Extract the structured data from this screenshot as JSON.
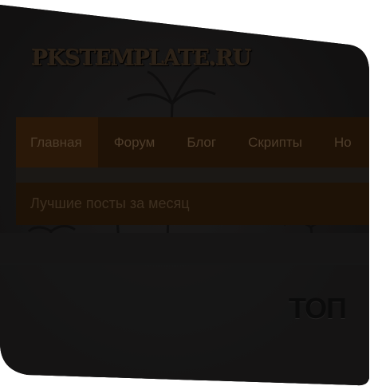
{
  "site": {
    "logo_text": "PKSTEMPLATE.RU"
  },
  "nav": {
    "items": [
      {
        "label": "Главная",
        "active": true
      },
      {
        "label": "Форум",
        "active": false
      },
      {
        "label": "Блог",
        "active": false
      },
      {
        "label": "Скрипты",
        "active": false
      },
      {
        "label": "Но",
        "active": false
      }
    ]
  },
  "banner": {
    "title": "Лучшие посты за месяц"
  },
  "content": {
    "top_label": "ТОП"
  },
  "colors": {
    "background": "#141313",
    "nav_bar": "#1f1206",
    "nav_text": "#4e3d2b",
    "banner_bg": "#1e1206",
    "banner_text": "#3d2f20"
  }
}
